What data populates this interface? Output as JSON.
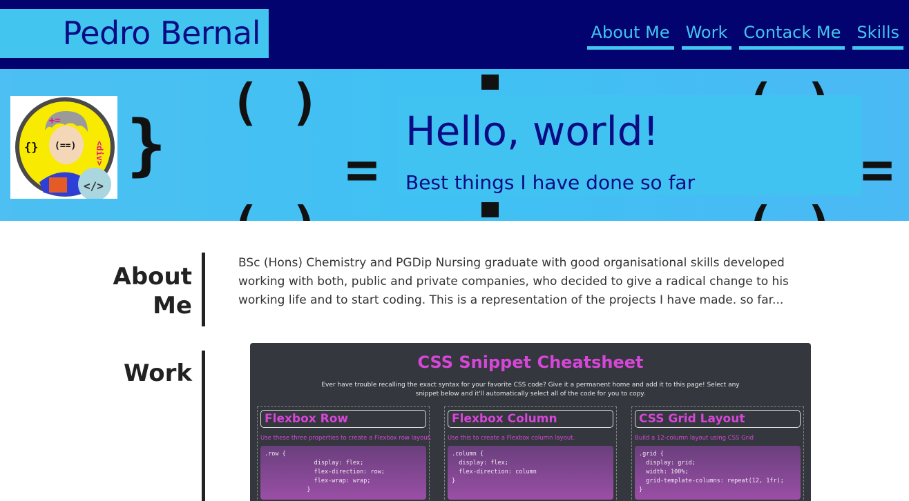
{
  "header": {
    "brand": "Pedro Bernal",
    "nav": [
      "About Me",
      "Work",
      "Contack Me",
      "Skills"
    ]
  },
  "hero": {
    "title": "Hello, world!",
    "subtitle": "Best things I have done so far"
  },
  "about": {
    "heading_line1": "About",
    "heading_line2": "Me",
    "text": "BSc (Hons) Chemistry and PGDip Nursing graduate with good organisational skills developed working with both, public and private companies, who decided to give a radical change to his working life and to start coding. This is a representation of the projects I have made. so far..."
  },
  "work": {
    "heading": "Work",
    "project": {
      "title": "CSS Snippet Cheatsheet",
      "description": "Ever have trouble recalling the exact syntax for your favorite CSS code? Give it a permanent home and add it to this page! Select any snippet below and it'll automatically select all of the code for you to copy.",
      "cards": [
        {
          "title": "Flexbox Row",
          "note": "Use these three properties to create a Flexbox row layout.",
          "code": ".row {\n              display: flex;\n              flex-direction: row;\n              flex-wrap: wrap;\n            }"
        },
        {
          "title": "Flexbox Column",
          "note": "Use this to create a Flexbox column layout.",
          "code": ".column {\n  display: flex;\n  flex-direction: column\n}"
        },
        {
          "title": "CSS Grid Layout",
          "note": "Build a 12-column layout using CSS Grid",
          "code": ".grid {\n  display: grid;\n  width: 100%;\n  grid-template-columns: repeat(12, 1fr);\n}"
        }
      ]
    }
  },
  "colors": {
    "header_bg": "#03036f",
    "accent": "#42c5ef",
    "brand_text": "#0b0b84",
    "snippet_accent": "#d646d8"
  },
  "icons": [
    "avatar-icon"
  ]
}
